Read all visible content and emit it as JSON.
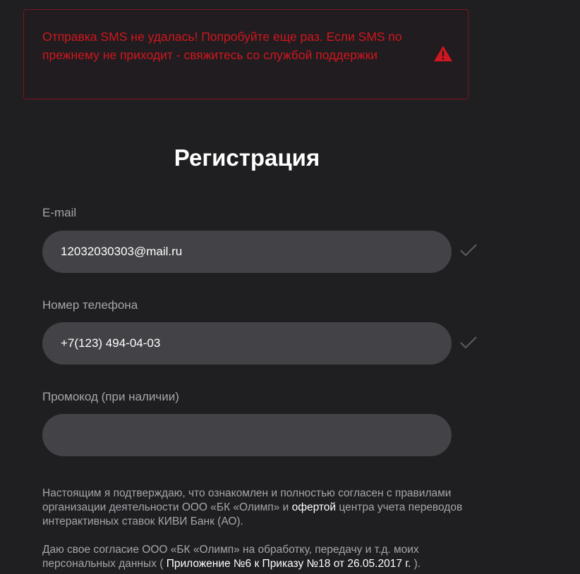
{
  "alert": {
    "message": "Отправка SMS не удалась! Попробуйте еще раз. Если SMS по прежнему не приходит - свяжитесь со службой поддержки",
    "icon": "warning-icon",
    "color": "#d0171f"
  },
  "form": {
    "title": "Регистрация",
    "email": {
      "label": "E-mail",
      "value": "12032030303@mail.ru",
      "status_icon": "checkmark-icon"
    },
    "phone": {
      "label": "Номер телефона",
      "value": "+7(123) 494-04-03",
      "status_icon": "checkmark-icon"
    },
    "promo": {
      "label": "Промокод (при наличии)",
      "value": ""
    }
  },
  "legal": {
    "para1_text1": "Настоящим я подтверждаю, что ознакомлен и полностью согласен с правилами организации деятельности ООО «БК «Олимп» и ",
    "para1_link": "офертой",
    "para1_text2": " центра учета переводов интерактивных ставок КИВИ Банк (АО).",
    "para2_text1": "Даю свое согласие ООО «БК «Олимп» на обработку, передачу и т.д. моих персональных данных ( ",
    "para2_link": "Приложение №6 к Приказу №18 от 26.05.2017 г.",
    "para2_text2": " )."
  },
  "colors": {
    "background": "#1f1e21",
    "input_bg": "#434247",
    "label": "#a6a5ab",
    "error": "#d0171f"
  }
}
